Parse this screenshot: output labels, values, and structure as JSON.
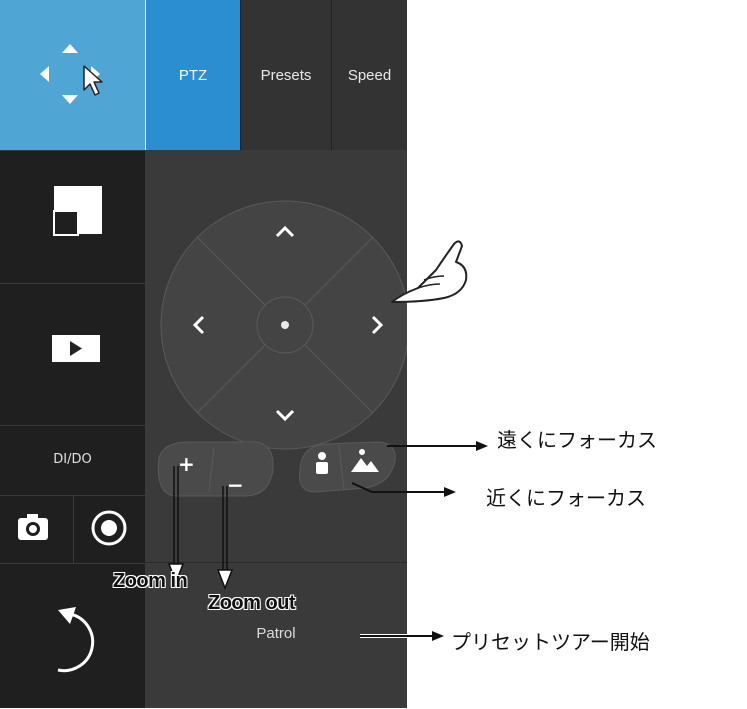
{
  "tabs": [
    {
      "label": "PTZ",
      "active": true
    },
    {
      "label": "Presets",
      "active": false
    },
    {
      "label": "Speed",
      "active": false
    }
  ],
  "sidebar": {
    "items": [
      {
        "name": "move-mode",
        "icon": "move-arrows-icon"
      },
      {
        "name": "layout",
        "icon": "layout-icon"
      },
      {
        "name": "playback",
        "icon": "play-icon"
      },
      {
        "name": "dido",
        "label": "DI/DO"
      },
      {
        "name": "snapshot",
        "icon": "camera-icon"
      },
      {
        "name": "record",
        "icon": "record-icon"
      },
      {
        "name": "back",
        "icon": "back-arrow-icon"
      }
    ]
  },
  "ptz": {
    "zoom_in_symbol": "+",
    "zoom_out_symbol": "−",
    "patrol_label": "Patrol"
  },
  "annotations": {
    "focus_far": "遠くにフォーカス",
    "focus_near": "近くにフォーカス",
    "zoom_in": "Zoom in",
    "zoom_out": "Zoom out",
    "preset_tour": "プリセットツアー開始"
  },
  "colors": {
    "accent": "#2a8ed0",
    "move_tile": "#4fa6d5",
    "panel": "#3a3a3a",
    "nav": "#1f1f1f"
  }
}
